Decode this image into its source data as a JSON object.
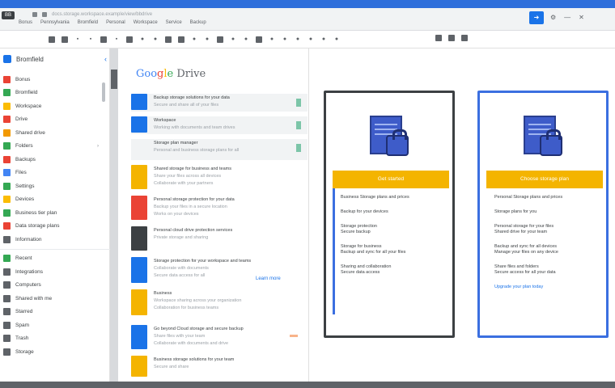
{
  "browser": {
    "tab_logo": "BB",
    "tabs": [
      "Bonus",
      "Pennsylvania",
      "Bromfield",
      "Personal",
      "Workspace",
      "Service",
      "Backup"
    ],
    "url_text": "docs.storage.workspace.example/view/bbdrive"
  },
  "header": {
    "share_icon": "share-icon",
    "colors": {
      "accent": "#1a73e8",
      "topbar": "#2f6fdb"
    }
  },
  "sidebar": {
    "title": "Bromfield",
    "items": [
      {
        "label": "Bonus",
        "color": "#ea4335"
      },
      {
        "label": "Bromfield",
        "color": "#34a853"
      },
      {
        "label": "Workspace",
        "color": "#fbbc04"
      },
      {
        "label": "Drive",
        "color": "#ea4335"
      },
      {
        "label": "Shared drive",
        "color": "#f29900"
      },
      {
        "label": "Folders",
        "color": "#34a853"
      },
      {
        "label": "Backups",
        "color": "#ea4335"
      },
      {
        "label": "Files",
        "color": "#4285f4"
      },
      {
        "label": "Settings",
        "color": "#34a853"
      },
      {
        "label": "Devices",
        "color": "#fbbc04"
      },
      {
        "label": "Business tier plan",
        "color": "#34a853"
      },
      {
        "label": "Data storage plans",
        "color": "#ea4335"
      },
      {
        "label": "Information",
        "color": "#5f6368"
      }
    ],
    "items_lower": [
      {
        "label": "Recent",
        "color": "#34a853"
      },
      {
        "label": "Integrations",
        "color": "#5f6368"
      },
      {
        "label": "Computers",
        "color": "#5f6368"
      },
      {
        "label": "Shared with me",
        "color": "#5f6368"
      },
      {
        "label": "Starred",
        "color": "#5f6368"
      },
      {
        "label": "Spam",
        "color": "#5f6368"
      },
      {
        "label": "Trash",
        "color": "#5f6368"
      },
      {
        "label": "Storage",
        "color": "#5f6368"
      }
    ]
  },
  "main": {
    "title_parts": [
      "Goo",
      "g",
      "l",
      "e",
      " Drive"
    ],
    "rows": [
      {
        "lines": [
          "Backup storage solutions for your data",
          "Secure and share all of your files"
        ],
        "thumb": "#1a73e8",
        "shaded": true
      },
      {
        "lines": [
          "Workspace",
          "Working with documents and team drives"
        ],
        "thumb": "#1a73e8",
        "shaded": true
      },
      {
        "lines": [
          "Storage plan manager",
          "Personal and business storage plans for all"
        ],
        "thumb": "",
        "shaded": true
      },
      {
        "lines": [
          "Shared storage for business and teams",
          "Share your files across all devices",
          "Collaborate with your partners"
        ],
        "thumb": "#f4b400",
        "shaded": false
      },
      {
        "lines": [
          "Personal storage protection for your data",
          "Backup your files in a secure location",
          "Works on your devices"
        ],
        "thumb": "#ea4335",
        "shaded": false
      },
      {
        "lines": [
          "Personal cloud drive protection services",
          "Private storage and sharing"
        ],
        "thumb": "#3c4043",
        "shaded": false
      },
      {
        "lines": [
          "Storage protection for your workspace and teams",
          "Collaborate with documents",
          "Secure data access for all"
        ],
        "thumb": "#1a73e8",
        "shaded": false
      },
      {
        "lines": [
          "Business",
          "Workspace sharing across your organization",
          "Collaboration for business teams"
        ],
        "thumb": "#f4b400",
        "shaded": false
      },
      {
        "lines": [
          "Go beyond Cloud storage and secure backup",
          "Share files with your team",
          "Collaborate with documents and drive"
        ],
        "thumb": "#1a73e8",
        "shaded": false
      },
      {
        "lines": [
          "Business storage solutions for your team",
          "Secure and share"
        ],
        "thumb": "#f4b400",
        "shaded": false
      }
    ],
    "view_link": "Learn more"
  },
  "cards": [
    {
      "banner": "Get started",
      "lines": [
        "Business Storage plans and prices",
        "Backup for your devices",
        "Storage protection",
        "Secure backup",
        "Storage for business",
        "Backup and sync for all your files",
        "Sharing and collaboration",
        "Secure data access"
      ],
      "blue_line": ""
    },
    {
      "banner": "Choose storage plan",
      "lines": [
        "Personal Storage plans and prices",
        "Storage plans for you",
        "Personal storage for your files",
        "Shared drive for your team",
        "Backup and sync for all devices",
        "Manage your files on any device",
        "Share files and folders",
        "Secure access for all your data"
      ],
      "blue_line": "Upgrade your plan today"
    }
  ]
}
